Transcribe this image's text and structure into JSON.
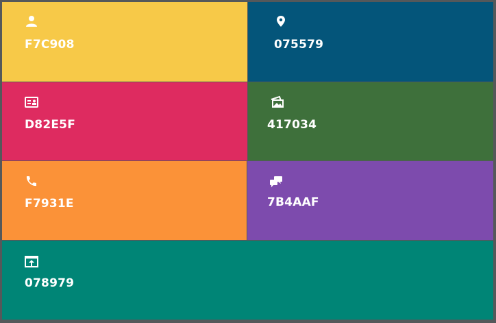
{
  "tiles": [
    {
      "id": "yellow",
      "label": "F7C908",
      "icon": "user-icon",
      "color": "#F7C908"
    },
    {
      "id": "blue",
      "label": "075579",
      "icon": "map-pin-icon",
      "color": "#075579"
    },
    {
      "id": "pink",
      "label": "D82E5F",
      "icon": "id-card-icon",
      "color": "#D82E5F"
    },
    {
      "id": "green",
      "label": "417034",
      "icon": "photos-icon",
      "color": "#417034"
    },
    {
      "id": "orange",
      "label": "F7931E",
      "icon": "phone-icon",
      "color": "#F7931E"
    },
    {
      "id": "purple",
      "label": "7B4AAF",
      "icon": "chat-bubbles-icon",
      "color": "#7B4AAF"
    },
    {
      "id": "teal",
      "label": "078979",
      "icon": "share-upload-icon",
      "color": "#078979"
    }
  ]
}
